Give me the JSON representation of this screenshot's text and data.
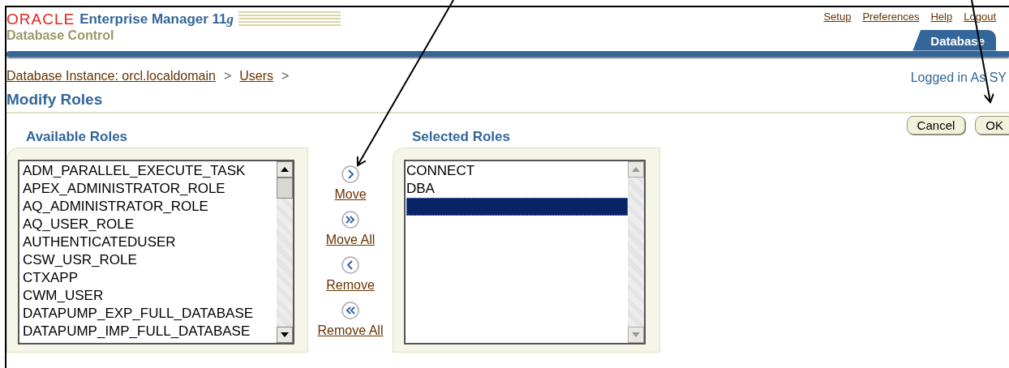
{
  "header": {
    "logo_brand": "ORACLE",
    "product": "Enterprise Manager 11",
    "product_suffix": "g",
    "subtitle": "Database Control",
    "global_links": [
      "Setup",
      "Preferences",
      "Help",
      "Logout"
    ],
    "tabs": [
      {
        "label": "Database",
        "selected": true
      }
    ]
  },
  "breadcrumb": [
    "Database Instance: orcl.localdomain",
    "Users"
  ],
  "breadcrumb_separator": ">",
  "logged_in": "Logged in As SY",
  "page_title": "Modify Roles",
  "buttons": [
    "Cancel",
    "OK"
  ],
  "available_roles": {
    "title": "Available Roles",
    "items": [
      {
        "label": "ADM_PARALLEL_EXECUTE_TASK",
        "selected": false
      },
      {
        "label": "APEX_ADMINISTRATOR_ROLE",
        "selected": false
      },
      {
        "label": "AQ_ADMINISTRATOR_ROLE",
        "selected": false
      },
      {
        "label": "AQ_USER_ROLE",
        "selected": false
      },
      {
        "label": "AUTHENTICATEDUSER",
        "selected": false
      },
      {
        "label": "CSW_USR_ROLE",
        "selected": false
      },
      {
        "label": "CTXAPP",
        "selected": false
      },
      {
        "label": "CWM_USER",
        "selected": false
      },
      {
        "label": "DATAPUMP_EXP_FULL_DATABASE",
        "selected": false
      },
      {
        "label": "DATAPUMP_IMP_FULL_DATABASE",
        "selected": false
      }
    ]
  },
  "shuttle_actions": [
    {
      "kind": "move",
      "label": "Move"
    },
    {
      "kind": "move_all",
      "label": "Move All"
    },
    {
      "kind": "remove",
      "label": "Remove"
    },
    {
      "kind": "remove_all",
      "label": "Remove All"
    }
  ],
  "selected_roles": {
    "title": "Selected Roles",
    "items": [
      {
        "kind": "role",
        "label": "CONNECT",
        "selected": false
      },
      {
        "kind": "role",
        "label": "DBA",
        "selected": false
      },
      {
        "kind": "blank",
        "selected": true
      }
    ]
  }
}
